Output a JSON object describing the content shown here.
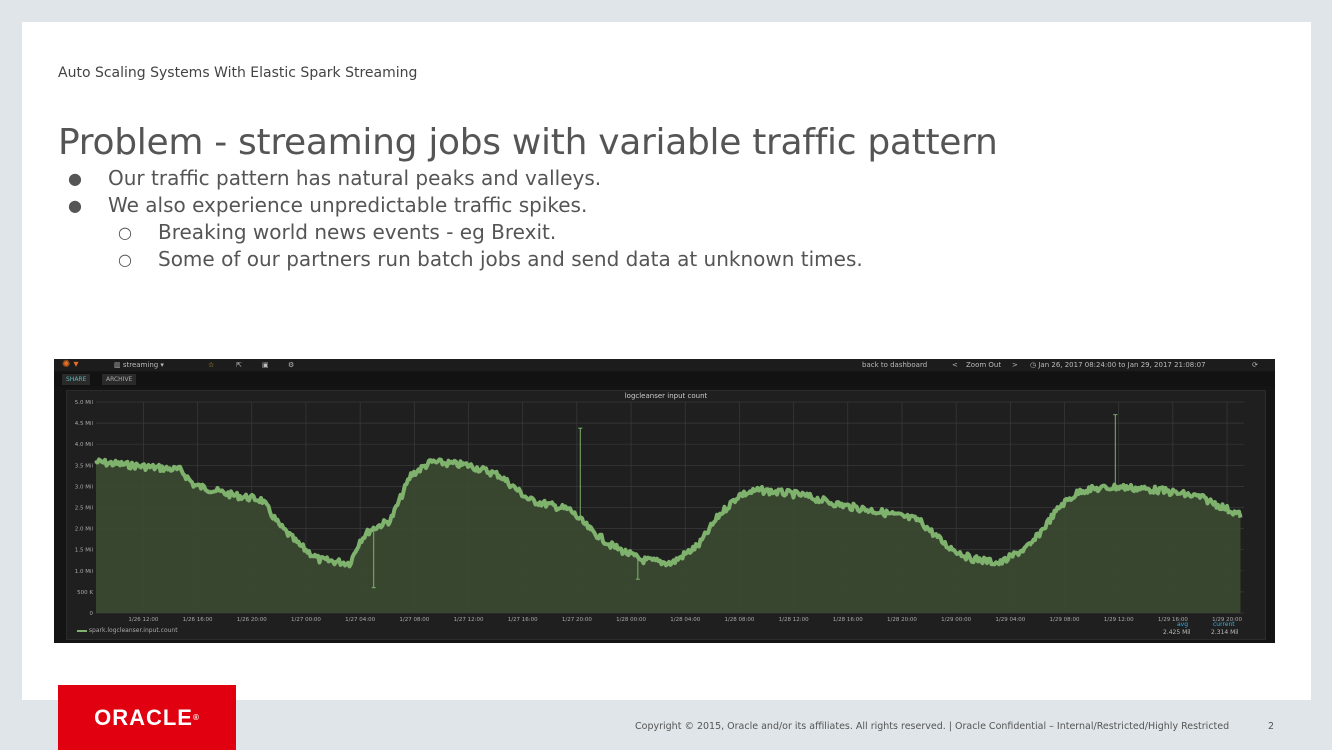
{
  "slide": {
    "kicker": "Auto Scaling Systems With Elastic Spark Streaming",
    "title": "Problem - streaming jobs with variable traffic pattern",
    "bullets": [
      {
        "level": 1,
        "marker": "●",
        "text": "Our traffic pattern has natural peaks and valleys."
      },
      {
        "level": 1,
        "marker": "●",
        "text": "We also experience unpredictable traffic spikes."
      },
      {
        "level": 2,
        "marker": "○",
        "text": "Breaking world news events - eg Brexit."
      },
      {
        "level": 2,
        "marker": "○",
        "text": "Some of our partners run batch jobs and send data at unknown times."
      }
    ],
    "footer": "Copyright © 2015, Oracle and/or its affiliates. All rights reserved.  |  Oracle Confidential – Internal/Restricted/Highly Restricted",
    "page_number": "2",
    "logo_text": "ORACLE",
    "brand_color": "#e0000f"
  },
  "grafana": {
    "dashboard": "streaming",
    "back_link": "back to dashboard",
    "zoom_out": "Zoom Out",
    "time_range": "Jan 26, 2017 08:24:00 to Jan 29, 2017 21:08:07",
    "chips": [
      "SHARE",
      "ARCHIVE"
    ],
    "panel_title": "logcleanser input count",
    "legend_series": "spark.logcleanser.input.count",
    "avg_label": "avg",
    "avg_value": "2.425 Mil",
    "current_label": "current",
    "current_value": "2.314 Mil"
  },
  "chart_data": {
    "type": "area",
    "title": "logcleanser input count",
    "xlim": [
      "1/26 08:30",
      "1/29 21:15"
    ],
    "ylim": [
      0,
      5000000
    ],
    "y_ticks": [
      "0",
      "500 K",
      "1.0 Mil",
      "1.5 Mil",
      "2.0 Mil",
      "2.5 Mil",
      "3.0 Mil",
      "3.5 Mil",
      "4.0 Mil",
      "4.5 Mil",
      "5.0 Mil"
    ],
    "x_ticks": [
      "1/26 12:00",
      "1/26 16:00",
      "1/26 20:00",
      "1/27 00:00",
      "1/27 04:00",
      "1/27 08:00",
      "1/27 12:00",
      "1/27 16:00",
      "1/27 20:00",
      "1/28 00:00",
      "1/28 04:00",
      "1/28 08:00",
      "1/28 12:00",
      "1/28 16:00",
      "1/28 20:00",
      "1/29 00:00",
      "1/29 04:00",
      "1/29 08:00",
      "1/29 12:00",
      "1/29 16:00",
      "1/29 20:00"
    ],
    "grid": true,
    "series_color": "#7eb26d",
    "x": [
      "1/26 08:30",
      "1/26 14:45",
      "1/26 15:45",
      "1/26 18:30",
      "1/26 20:45",
      "1/26 22:00",
      "1/26 23:30",
      "1/27 01:00",
      "1/27 03:15",
      "1/27 04:00",
      "1/27 04:45",
      "1/27 06:15",
      "1/27 07:45",
      "1/27 09:15",
      "1/27 12:00",
      "1/27 14:15",
      "1/27 16:30",
      "1/27 19:30",
      "1/27 21:00",
      "1/27 22:30",
      "1/28 00:45",
      "1/28 03:00",
      "1/28 05:00",
      "1/28 06:30",
      "1/28 08:00",
      "1/28 09:30",
      "1/28 12:30",
      "1/28 15:30",
      "1/28 18:30",
      "1/28 21:15",
      "1/28 23:15",
      "1/29 01:00",
      "1/29 03:15",
      "1/29 05:30",
      "1/29 07:45",
      "1/29 09:15",
      "1/29 12:00",
      "1/29 15:00",
      "1/29 18:00",
      "1/29 21:00"
    ],
    "y": [
      3580000,
      3390000,
      3030000,
      2800000,
      2680000,
      2090000,
      1610000,
      1260000,
      1180000,
      1730000,
      1970000,
      2200000,
      3270000,
      3580000,
      3500000,
      3270000,
      2680000,
      2440000,
      1970000,
      1610000,
      1260000,
      1180000,
      1610000,
      2320000,
      2800000,
      2910000,
      2800000,
      2560000,
      2390000,
      2200000,
      1610000,
      1300000,
      1180000,
      1610000,
      2560000,
      2910000,
      2990000,
      2910000,
      2750000,
      2320000
    ],
    "spikes": [
      {
        "x": "1/27 05:00",
        "y": 600000
      },
      {
        "x": "1/27 20:15",
        "y": 4380000
      },
      {
        "x": "1/28 00:30",
        "y": 800000
      },
      {
        "x": "1/29 11:45",
        "y": 4700000
      }
    ]
  }
}
